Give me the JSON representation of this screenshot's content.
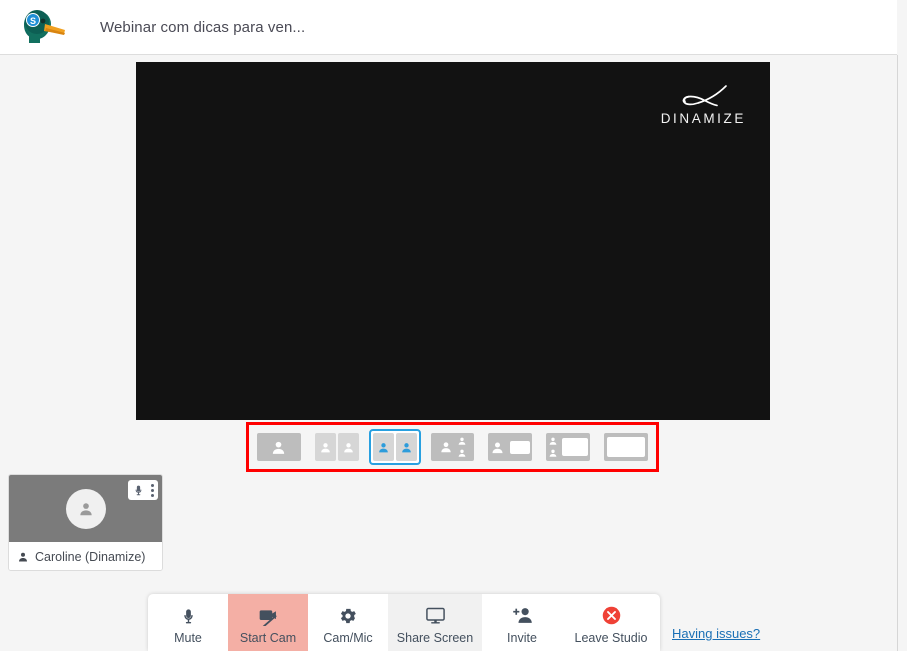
{
  "header": {
    "logo_icon": "duck-mallard-logo",
    "title": "Webinar com dicas para ven..."
  },
  "stage": {
    "watermark_icon": "dinamize-swoosh-icon",
    "watermark_text": "DINAMIZE",
    "background_color": "#121212"
  },
  "layout_selector": {
    "highlight_color": "#ff0000",
    "selected_color": "#28a0e0",
    "selected_index": 2,
    "options": [
      {
        "name": "layout-single-speaker",
        "label": "Single speaker"
      },
      {
        "name": "layout-two-equal",
        "label": "Two equal"
      },
      {
        "name": "layout-two-equal-selected",
        "label": "Two equal highlighted"
      },
      {
        "name": "layout-one-plus-two",
        "label": "One plus two"
      },
      {
        "name": "layout-speaker-plus-screen",
        "label": "Speaker plus screen"
      },
      {
        "name": "layout-two-small-plus-screen",
        "label": "Two small plus screen"
      },
      {
        "name": "layout-screen-only",
        "label": "Screen only"
      }
    ]
  },
  "participant": {
    "name": "Caroline (Dinamize)",
    "avatar_icon": "person-avatar-icon",
    "mic_icon": "microphone-icon",
    "menu_icon": "kebab-menu-icon",
    "name_icon": "person-icon"
  },
  "toolbar": {
    "buttons": [
      {
        "name": "mute-button",
        "label": "Mute",
        "icon": "microphone-icon",
        "style": "plain"
      },
      {
        "name": "start-cam-button",
        "label": "Start Cam",
        "icon": "camera-off-icon",
        "style": "accent"
      },
      {
        "name": "cam-mic-button",
        "label": "Cam/Mic",
        "icon": "gear-icon",
        "style": "plain"
      },
      {
        "name": "share-screen-button",
        "label": "Share Screen",
        "icon": "monitor-icon",
        "style": "subtle"
      },
      {
        "name": "invite-button",
        "label": "Invite",
        "icon": "person-add-icon",
        "style": "plain"
      },
      {
        "name": "leave-studio-button",
        "label": "Leave Studio",
        "icon": "close-circle-icon",
        "style": "plain"
      }
    ],
    "accent_color": "#f4afa5",
    "leave_icon_color": "#ef4136"
  },
  "help": {
    "label": "Having issues?",
    "color": "#1a6fb5"
  }
}
